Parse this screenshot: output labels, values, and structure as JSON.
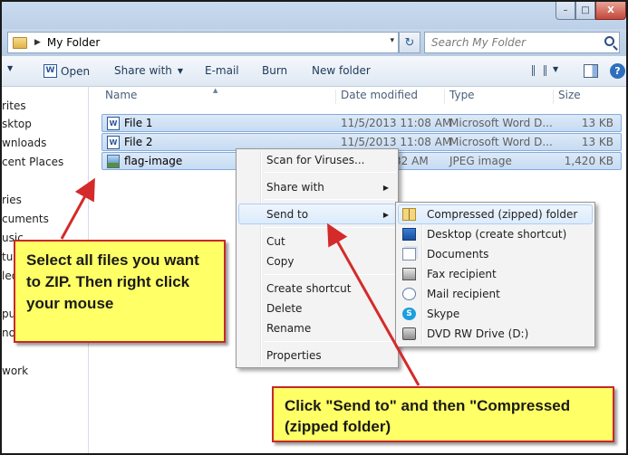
{
  "window": {
    "minimize": "–",
    "maximize": "□",
    "close": "X"
  },
  "address": {
    "path": "My Folder",
    "separator": "▶",
    "dropdown": "▾",
    "refresh": "↻"
  },
  "search": {
    "placeholder": "Search My Folder"
  },
  "toolbar": {
    "open": "Open",
    "open_icon": "W",
    "share_with": "Share with",
    "email": "E-mail",
    "burn": "Burn",
    "new_folder": "New folder",
    "caret": "▼",
    "help": "?"
  },
  "nav": {
    "items": [
      "rites",
      "sktop",
      "wnloads",
      "cent Places",
      "ries",
      "cuments",
      "usic",
      "tu",
      "leo",
      "pu",
      "no",
      "work"
    ]
  },
  "columns": {
    "name": "Name",
    "date": "Date modified",
    "type": "Type",
    "size": "Size",
    "sort_indicator": "▲"
  },
  "files": [
    {
      "name": "File 1",
      "date": "11/5/2013 11:08 AM",
      "type": "Microsoft Word D...",
      "size": "13 KB",
      "icon": "word-doc-icon"
    },
    {
      "name": "File 2",
      "date": "11/5/2013 11:08 AM",
      "type": "Microsoft Word D...",
      "size": "13 KB",
      "icon": "word-doc-icon"
    },
    {
      "name": "flag-image",
      "date": ":32 AM",
      "type": "JPEG image",
      "size": "1,420 KB",
      "icon": "image-icon"
    }
  ],
  "context_menu": {
    "scan": "Scan for Viruses...",
    "share_with": "Share with",
    "send_to": "Send to",
    "cut": "Cut",
    "copy": "Copy",
    "create_shortcut": "Create shortcut",
    "delete": "Delete",
    "rename": "Rename",
    "properties": "Properties",
    "submenu_arrow": "▶"
  },
  "send_to_menu": {
    "compressed": "Compressed (zipped) folder",
    "desktop": "Desktop (create shortcut)",
    "documents": "Documents",
    "fax": "Fax recipient",
    "mail": "Mail recipient",
    "skype": "Skype",
    "dvd": "DVD RW Drive (D:)",
    "skype_glyph": "S"
  },
  "callouts": {
    "step1": "Select all files you want to ZIP. Then right click your mouse",
    "step2": "Click \"Send to\" and then \"Compressed (zipped folder)"
  },
  "colors": {
    "callout_fill": "#ffff66",
    "callout_border": "#c8282a",
    "arrow": "#d42a2a",
    "selection": "#c6dbf3"
  }
}
